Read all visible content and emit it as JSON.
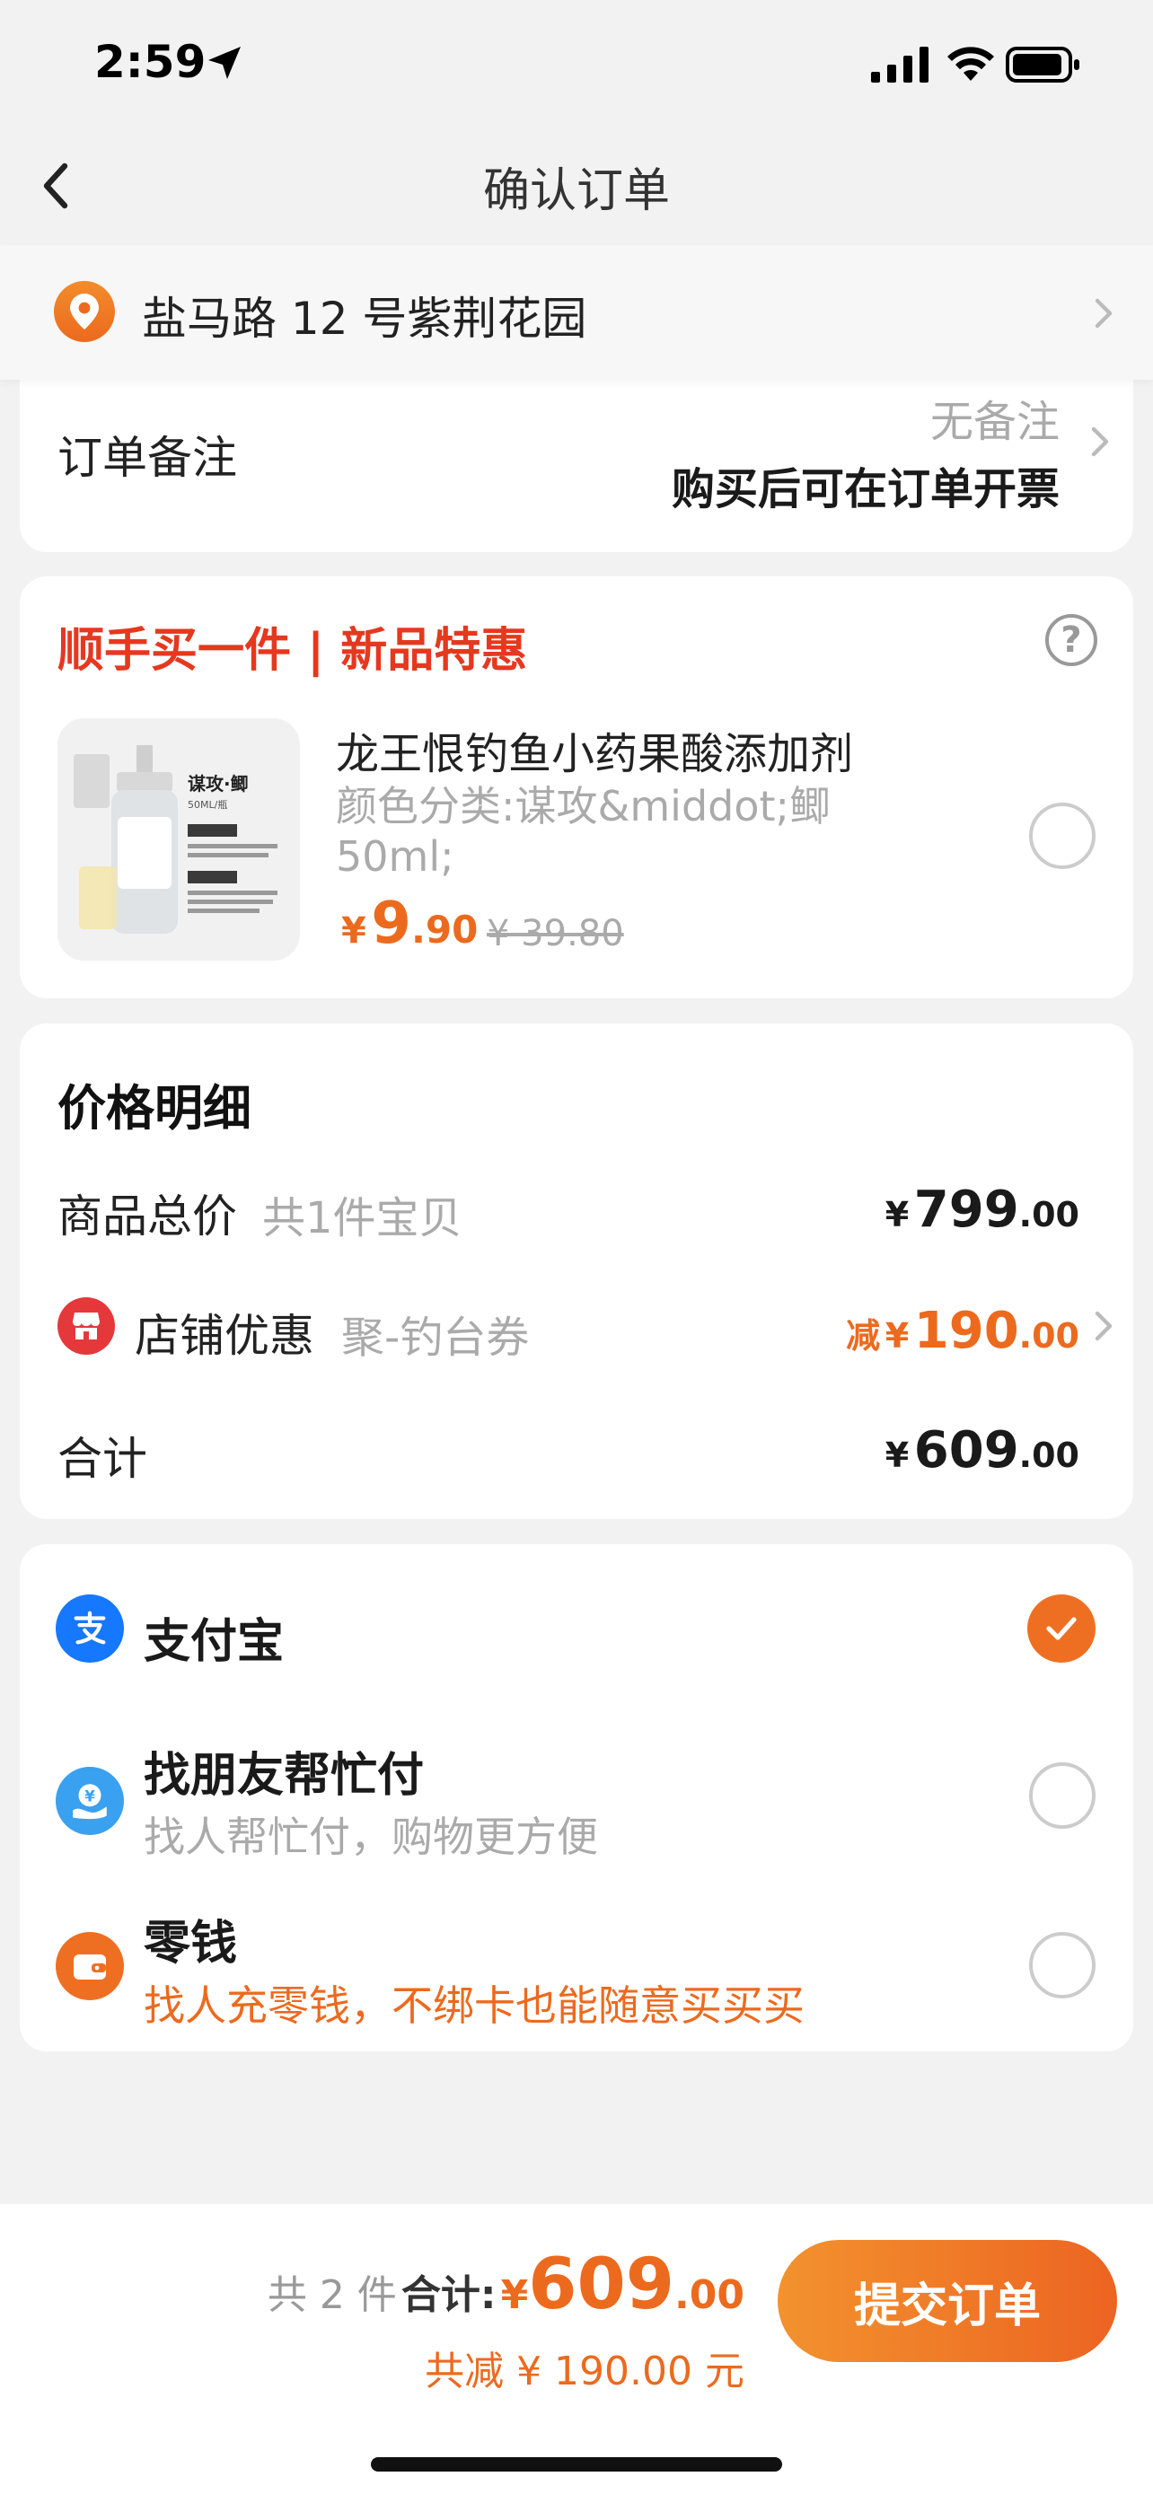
{
  "status_bar": {
    "time": "2:59"
  },
  "header": {
    "title": "确认订单"
  },
  "address": {
    "text": "盐马路 12 号紫荆花园"
  },
  "remark": {
    "label": "订单备注",
    "value": "无备注",
    "invoice_text": "购买后可在订单开票"
  },
  "addon": {
    "title": "顺手买一件 | 新品特惠",
    "product": {
      "name": "龙王恨钓鱼小药果酸添加剂",
      "spec": "颜色分类:谋攻&middot;鲫 50ml;",
      "price_currency": "¥",
      "price_int": "9",
      "price_dec": ".90",
      "original_price": "¥ 39.80",
      "image_label": "谋攻·鲫",
      "image_sub": "50ML/瓶"
    }
  },
  "price_detail": {
    "title": "价格明细",
    "goods_total_label": "商品总价",
    "goods_total_count": "共1件宝贝",
    "goods_total_cur": "¥",
    "goods_total_int": "799",
    "goods_total_dec": ".00",
    "shop_discount_label": "店铺优惠",
    "shop_discount_name": "聚-钓台券",
    "shop_discount_prefix": "减",
    "shop_discount_cur": "¥",
    "shop_discount_int": "190",
    "shop_discount_dec": ".00",
    "total_label": "合计",
    "total_cur": "¥",
    "total_int": "609",
    "total_dec": ".00"
  },
  "payment": {
    "options": [
      {
        "name": "支付宝",
        "desc": "",
        "selected": true
      },
      {
        "name": "找朋友帮忙付",
        "desc": "找人帮忙付，购物更方便",
        "selected": false
      },
      {
        "name": "零钱",
        "desc": "找人充零钱，不绑卡也能随意买买买",
        "selected": false
      }
    ]
  },
  "footer": {
    "count_text": "共 2 件",
    "sum_label": "合计:",
    "sum_cur": "¥",
    "sum_int": "609",
    "sum_dec": ".00",
    "discount_text": "共减 ¥ 190.00 元",
    "submit_label": "提交订单"
  },
  "colors": {
    "accent": "#ec6a1e",
    "red": "#e5381f",
    "alipay": "#1677ff"
  }
}
